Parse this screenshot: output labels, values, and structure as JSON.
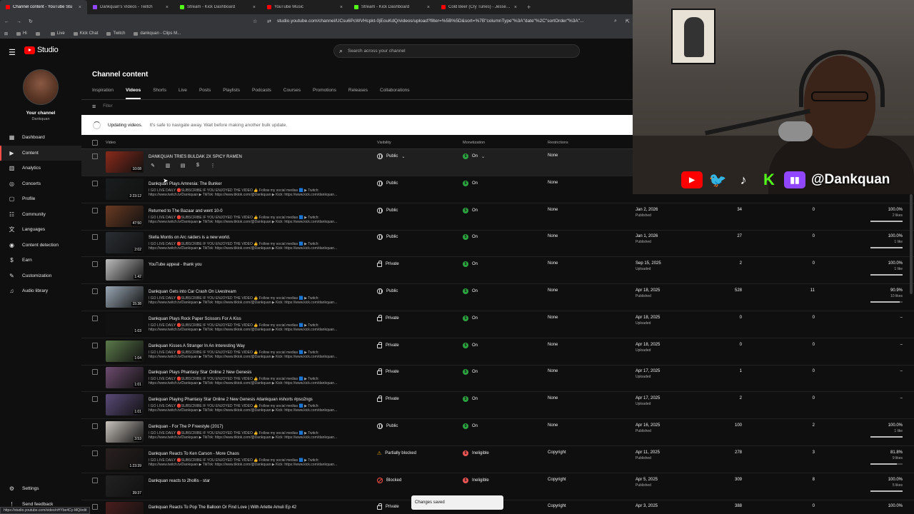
{
  "browser": {
    "tabs": [
      {
        "label": "Channel content - YouTube Stu",
        "color": "#ff0000",
        "active": true
      },
      {
        "label": "Dankquan's Videos - Twitch",
        "color": "#9146ff"
      },
      {
        "label": "Stream - Kick Dashboard",
        "color": "#53fc18"
      },
      {
        "label": "YouTube Music",
        "color": "#ff0000"
      },
      {
        "label": "Stream - Kick Dashboard",
        "color": "#53fc18"
      },
      {
        "label": "Cold Beer (Cry Tunes) - Jesse Sta",
        "color": "#ff0000"
      }
    ],
    "new_tab": "+",
    "url": "studio.youtube.com/channel/UCsu6PcWVHcpkt-0jEouKdQ/videos/upload?filter=%5B%5D&sort=%7B\"columnType\"%3A\"date\"%2C\"sortOrder\"%3A\"...",
    "bookmarks": [
      "Hi",
      "",
      "Live",
      "Kick Chat",
      "Twitch",
      "dankquan - Clips M..."
    ]
  },
  "header": {
    "logo_text": "Studio",
    "search_placeholder": "Search across your channel"
  },
  "sidebar": {
    "your_channel": "Your channel",
    "channel_name": "Dankquan",
    "items": [
      {
        "label": "Dashboard",
        "icon": "dashboard-icon",
        "glyph": "▦"
      },
      {
        "label": "Content",
        "icon": "content-icon",
        "glyph": "▶",
        "active": true
      },
      {
        "label": "Analytics",
        "icon": "analytics-icon",
        "glyph": "▥"
      },
      {
        "label": "Concerts",
        "icon": "concerts-icon",
        "glyph": "◎"
      },
      {
        "label": "Profile",
        "icon": "profile-icon",
        "glyph": "▢"
      },
      {
        "label": "Community",
        "icon": "community-icon",
        "glyph": "☷"
      },
      {
        "label": "Languages",
        "icon": "languages-icon",
        "glyph": "文"
      },
      {
        "label": "Content detection",
        "icon": "content-detection-icon",
        "glyph": "◉"
      },
      {
        "label": "Earn",
        "icon": "earn-icon",
        "glyph": "$"
      },
      {
        "label": "Customization",
        "icon": "customization-icon",
        "glyph": "✎"
      },
      {
        "label": "Audio library",
        "icon": "audio-library-icon",
        "glyph": "♫"
      }
    ],
    "bottom": [
      {
        "label": "Settings",
        "icon": "settings-icon",
        "glyph": "⚙"
      },
      {
        "label": "Send feedback",
        "icon": "feedback-icon",
        "glyph": "!"
      }
    ]
  },
  "main": {
    "title": "Channel content",
    "tabs": [
      "Inspiration",
      "Videos",
      "Shorts",
      "Live",
      "Posts",
      "Playlists",
      "Podcasts",
      "Courses",
      "Promotions",
      "Releases",
      "Collaborations"
    ],
    "active_tab": "Videos",
    "filter_placeholder": "Filter",
    "updating_bold": "Updating videos.",
    "updating_rest": "It's safe to navigate away. Wait before making another bulk update.",
    "columns": {
      "video": "Video",
      "visibility": "Visibility",
      "monetization": "Monetization",
      "restrictions": "Restrictions"
    }
  },
  "videos": [
    {
      "title": "DANKQUAN TRIES BULDAK 2X SPICY RAMEN",
      "desc1": "",
      "desc2": "",
      "duration": "10:08",
      "visibility": "Public",
      "vis_icon": "globe",
      "monetization": "On",
      "mon_icon": "green",
      "restrictions": "None",
      "date": "",
      "date_sub": "",
      "views": "",
      "comments": "",
      "likes": "",
      "likes_sub": "",
      "likes_ratio": null,
      "hovered": true,
      "thumb": "#8a2a1a"
    },
    {
      "title": "Dankquan Plays Amnesia: The Bunker",
      "desc1": "I GO LIVE DAILY 🔴SUBSCRIBE IF YOU ENJOYED THE VIDEO 👍 Follow my social medias 🟦 ▶ Twitch:",
      "desc2": "https://www.twitch.tv/Dankquan ▶ TikTok: https://www.tiktok.com/@Dankquan ▶ Kick: https://www.kick.com/dankquan...",
      "duration": "2:23:12",
      "visibility": "Public",
      "vis_icon": "globe",
      "monetization": "On",
      "mon_icon": "green",
      "restrictions": "None",
      "date": "",
      "date_sub": "",
      "views": "",
      "comments": "",
      "likes": "",
      "likes_sub": "",
      "likes_ratio": null,
      "thumb": "#1a1d1e"
    },
    {
      "title": "Returned to The Bazaar and went 10-0",
      "desc1": "I GO LIVE DAILY 🔴SUBSCRIBE IF YOU ENJOYED THE VIDEO 👍 Follow my social medias 🟦 ▶ Twitch:",
      "desc2": "https://www.twitch.tv/Dankquan ▶ TikTok: https://www.tiktok.com/@Dankquan ▶ Kick: https://www.kick.com/dankquan...",
      "duration": "47:50",
      "visibility": "Public",
      "vis_icon": "globe",
      "monetization": "On",
      "mon_icon": "green",
      "restrictions": "None",
      "date": "Jan 2, 2026",
      "date_sub": "Published",
      "views": "34",
      "comments": "0",
      "likes": "100.0%",
      "likes_sub": "2 likes",
      "likes_ratio": 1.0,
      "thumb": "#6a3a22"
    },
    {
      "title": "Stella Montis on Arc raiders is a new world.",
      "desc1": "I GO LIVE DAILY 🔴SUBSCRIBE IF YOU ENJOYED THE VIDEO 👍 Follow my social medias 🟦 ▶ Twitch:",
      "desc2": "https://www.twitch.tv/Dankquan ▶ TikTok: https://www.tiktok.com/@Dankquan ▶ Kick: https://www.kick.com/dankquan...",
      "duration": "2:02",
      "visibility": "Public",
      "vis_icon": "globe",
      "monetization": "On",
      "mon_icon": "green",
      "restrictions": "None",
      "date": "Jan 1, 2026",
      "date_sub": "Published",
      "views": "27",
      "comments": "0",
      "likes": "100.0%",
      "likes_sub": "1 like",
      "likes_ratio": 1.0,
      "thumb": "#2a2e33"
    },
    {
      "title": "YouTube appeal - thank you",
      "desc1": "",
      "desc2": "",
      "duration": "1:42",
      "visibility": "Private",
      "vis_icon": "lock",
      "monetization": "On",
      "mon_icon": "green",
      "restrictions": "None",
      "date": "Sep 15, 2025",
      "date_sub": "Uploaded",
      "views": "2",
      "comments": "0",
      "likes": "100.0%",
      "likes_sub": "1 like",
      "likes_ratio": 1.0,
      "thumb": "#bdbdbd"
    },
    {
      "title": "Dankquan Gets into Car Crash On Livestream",
      "desc1": "I GO LIVE DAILY 🔴SUBSCRIBE IF YOU ENJOYED THE VIDEO 👍 Follow my social medias 🟦 ▶ Twitch:",
      "desc2": "https://www.twitch.tv/Dankquan ▶ TikTok: https://www.tiktok.com/@Dankquan ▶ Kick: https://www.kick.com/dankquan...",
      "duration": "15:38",
      "visibility": "Public",
      "vis_icon": "globe",
      "monetization": "On",
      "mon_icon": "green",
      "restrictions": "None",
      "date": "Apr 18, 2025",
      "date_sub": "Published",
      "views": "528",
      "comments": "11",
      "likes": "90.9%",
      "likes_sub": "10 likes",
      "likes_ratio": 0.909,
      "thumb": "#9aa7b5"
    },
    {
      "title": "Dankquan Plays Rock Paper Scissors For A Kiss",
      "desc1": "I GO LIVE DAILY 🔴SUBSCRIBE IF YOU ENJOYED THE VIDEO 👍 Follow my social medias 🟦 ▶ Twitch:",
      "desc2": "https://www.twitch.tv/Dankquan ▶ TikTok: https://www.tiktok.com/@Dankquan ▶ Kick: https://www.kick.com/dankquan...",
      "duration": "1:03",
      "visibility": "Private",
      "vis_icon": "lock",
      "monetization": "On",
      "mon_icon": "green",
      "restrictions": "None",
      "date": "Apr 18, 2025",
      "date_sub": "Uploaded",
      "views": "0",
      "comments": "0",
      "likes": "–",
      "likes_sub": "",
      "likes_ratio": null,
      "thumb": "#111111"
    },
    {
      "title": "Dankquan Kisses A Stranger In An Interesting Way",
      "desc1": "I GO LIVE DAILY 🔴SUBSCRIBE IF YOU ENJOYED THE VIDEO 👍 Follow my social medias 🟦 ▶ Twitch:",
      "desc2": "https://www.twitch.tv/Dankquan ▶ TikTok: https://www.tiktok.com/@Dankquan ▶ Kick: https://www.kick.com/dankquan...",
      "duration": "1:04",
      "visibility": "Private",
      "vis_icon": "lock",
      "monetization": "On",
      "mon_icon": "green",
      "restrictions": "None",
      "date": "Apr 18, 2025",
      "date_sub": "Uploaded",
      "views": "0",
      "comments": "0",
      "likes": "–",
      "likes_sub": "",
      "likes_ratio": null,
      "thumb": "#5b7a4a"
    },
    {
      "title": "Dankquan Plays Phantasy Star Online 2 New Genesis",
      "desc1": "I GO LIVE DAILY 🔴SUBSCRIBE IF YOU ENJOYED THE VIDEO 👍 Follow my social medias 🟦 ▶ Twitch:",
      "desc2": "https://www.twitch.tv/Dankquan ▶ TikTok: https://www.tiktok.com/@Dankquan ▶ Kick: https://www.kick.com/dankquan...",
      "duration": "1:01",
      "visibility": "Private",
      "vis_icon": "lock",
      "monetization": "On",
      "mon_icon": "green",
      "restrictions": "None",
      "date": "Apr 17, 2025",
      "date_sub": "Uploaded",
      "views": "1",
      "comments": "0",
      "likes": "–",
      "likes_sub": "",
      "likes_ratio": null,
      "thumb": "#6c4b6e"
    },
    {
      "title": "Dankquan Playing Phantasy Star Online 2 New Genesis #dankquan #shorts #pso2ngs",
      "desc1": "I GO LIVE DAILY 🔴SUBSCRIBE IF YOU ENJOYED THE VIDEO 👍 Follow my social medias 🟦 ▶ Twitch:",
      "desc2": "https://www.twitch.tv/Dankquan ▶ TikTok: https://www.tiktok.com/@Dankquan ▶ Kick: https://www.kick.com/dankquan...",
      "duration": "1:01",
      "visibility": "Private",
      "vis_icon": "lock",
      "monetization": "On",
      "mon_icon": "green",
      "restrictions": "None",
      "date": "Apr 17, 2025",
      "date_sub": "Uploaded",
      "views": "2",
      "comments": "0",
      "likes": "–",
      "likes_sub": "",
      "likes_ratio": null,
      "thumb": "#5a4a78"
    },
    {
      "title": "Dankquan - For The P Freestyle (2017)",
      "desc1": "I GO LIVE DAILY 🔴SUBSCRIBE IF YOU ENJOYED THE VIDEO 👍 Follow my social medias 🟦 ▶ Twitch:",
      "desc2": "https://www.twitch.tv/Dankquan ▶ TikTok: https://www.tiktok.com/@Dankquan ▶ Kick: https://www.kick.com/dankquan...",
      "duration": "3:53",
      "visibility": "Public",
      "vis_icon": "globe",
      "monetization": "On",
      "mon_icon": "green",
      "restrictions": "None",
      "date": "Apr 16, 2025",
      "date_sub": "Published",
      "views": "100",
      "comments": "2",
      "likes": "100.0%",
      "likes_sub": "1 like",
      "likes_ratio": 1.0,
      "thumb": "#c9c3bd"
    },
    {
      "title": "Dankquan Reacts To Ken Carson - More Chaos",
      "desc1": "I GO LIVE DAILY 🔴SUBSCRIBE IF YOU ENJOYED THE VIDEO 👍 Follow my social medias 🟦 ▶ Twitch:",
      "desc2": "https://www.twitch.tv/Dankquan ▶ TikTok: https://www.tiktok.com/@Dankquan ▶ Kick: https://www.kick.com/dankquan...",
      "duration": "1:23:39",
      "visibility": "Partially blocked",
      "vis_icon": "warn",
      "monetization": "Ineligible",
      "mon_icon": "red",
      "restrictions": "Copyright",
      "date": "Apr 11, 2025",
      "date_sub": "Published",
      "views": "278",
      "comments": "3",
      "likes": "81.8%",
      "likes_sub": "9 likes",
      "likes_ratio": 0.818,
      "thumb": "#2a2020"
    },
    {
      "title": "Dankquan reacts to 2hollis - star",
      "desc1": "",
      "desc2": "",
      "duration": "39:37",
      "visibility": "Blocked",
      "vis_icon": "block",
      "monetization": "Ineligible",
      "mon_icon": "red",
      "restrictions": "Copyright",
      "date": "Apr 5, 2025",
      "date_sub": "Published",
      "views": "309",
      "comments": "8",
      "likes": "100.0%",
      "likes_sub": "5 likes",
      "likes_ratio": 1.0,
      "thumb": "#222222"
    },
    {
      "title": "Dankquan Reacts To Pop The Balloon Or Find Love | With Arlette Amuli Ep 42",
      "desc1": "",
      "desc2": "",
      "duration": "",
      "visibility": "Private",
      "vis_icon": "lock",
      "monetization": "",
      "mon_icon": "",
      "restrictions": "Copyright",
      "date": "Apr 3, 2025",
      "date_sub": "",
      "views": "388",
      "comments": "0",
      "likes": "100.0%",
      "likes_sub": "",
      "likes_ratio": null,
      "thumb": "#4a1d1d"
    }
  ],
  "webcam": {
    "handle": "@Dankquan",
    "socials": [
      "youtube-icon",
      "twitter-icon",
      "tiktok-icon",
      "kick-icon",
      "twitch-icon"
    ],
    "youtube_glyph": "▶",
    "twitter_glyph": "🐦",
    "tiktok_glyph": "♪",
    "kick_glyph": "K",
    "twitch_glyph": "▮▮"
  },
  "toast": "Changes saved",
  "status_url": "https://studio.youtube.com/video/nHYbe4Cy-MQ/edit"
}
